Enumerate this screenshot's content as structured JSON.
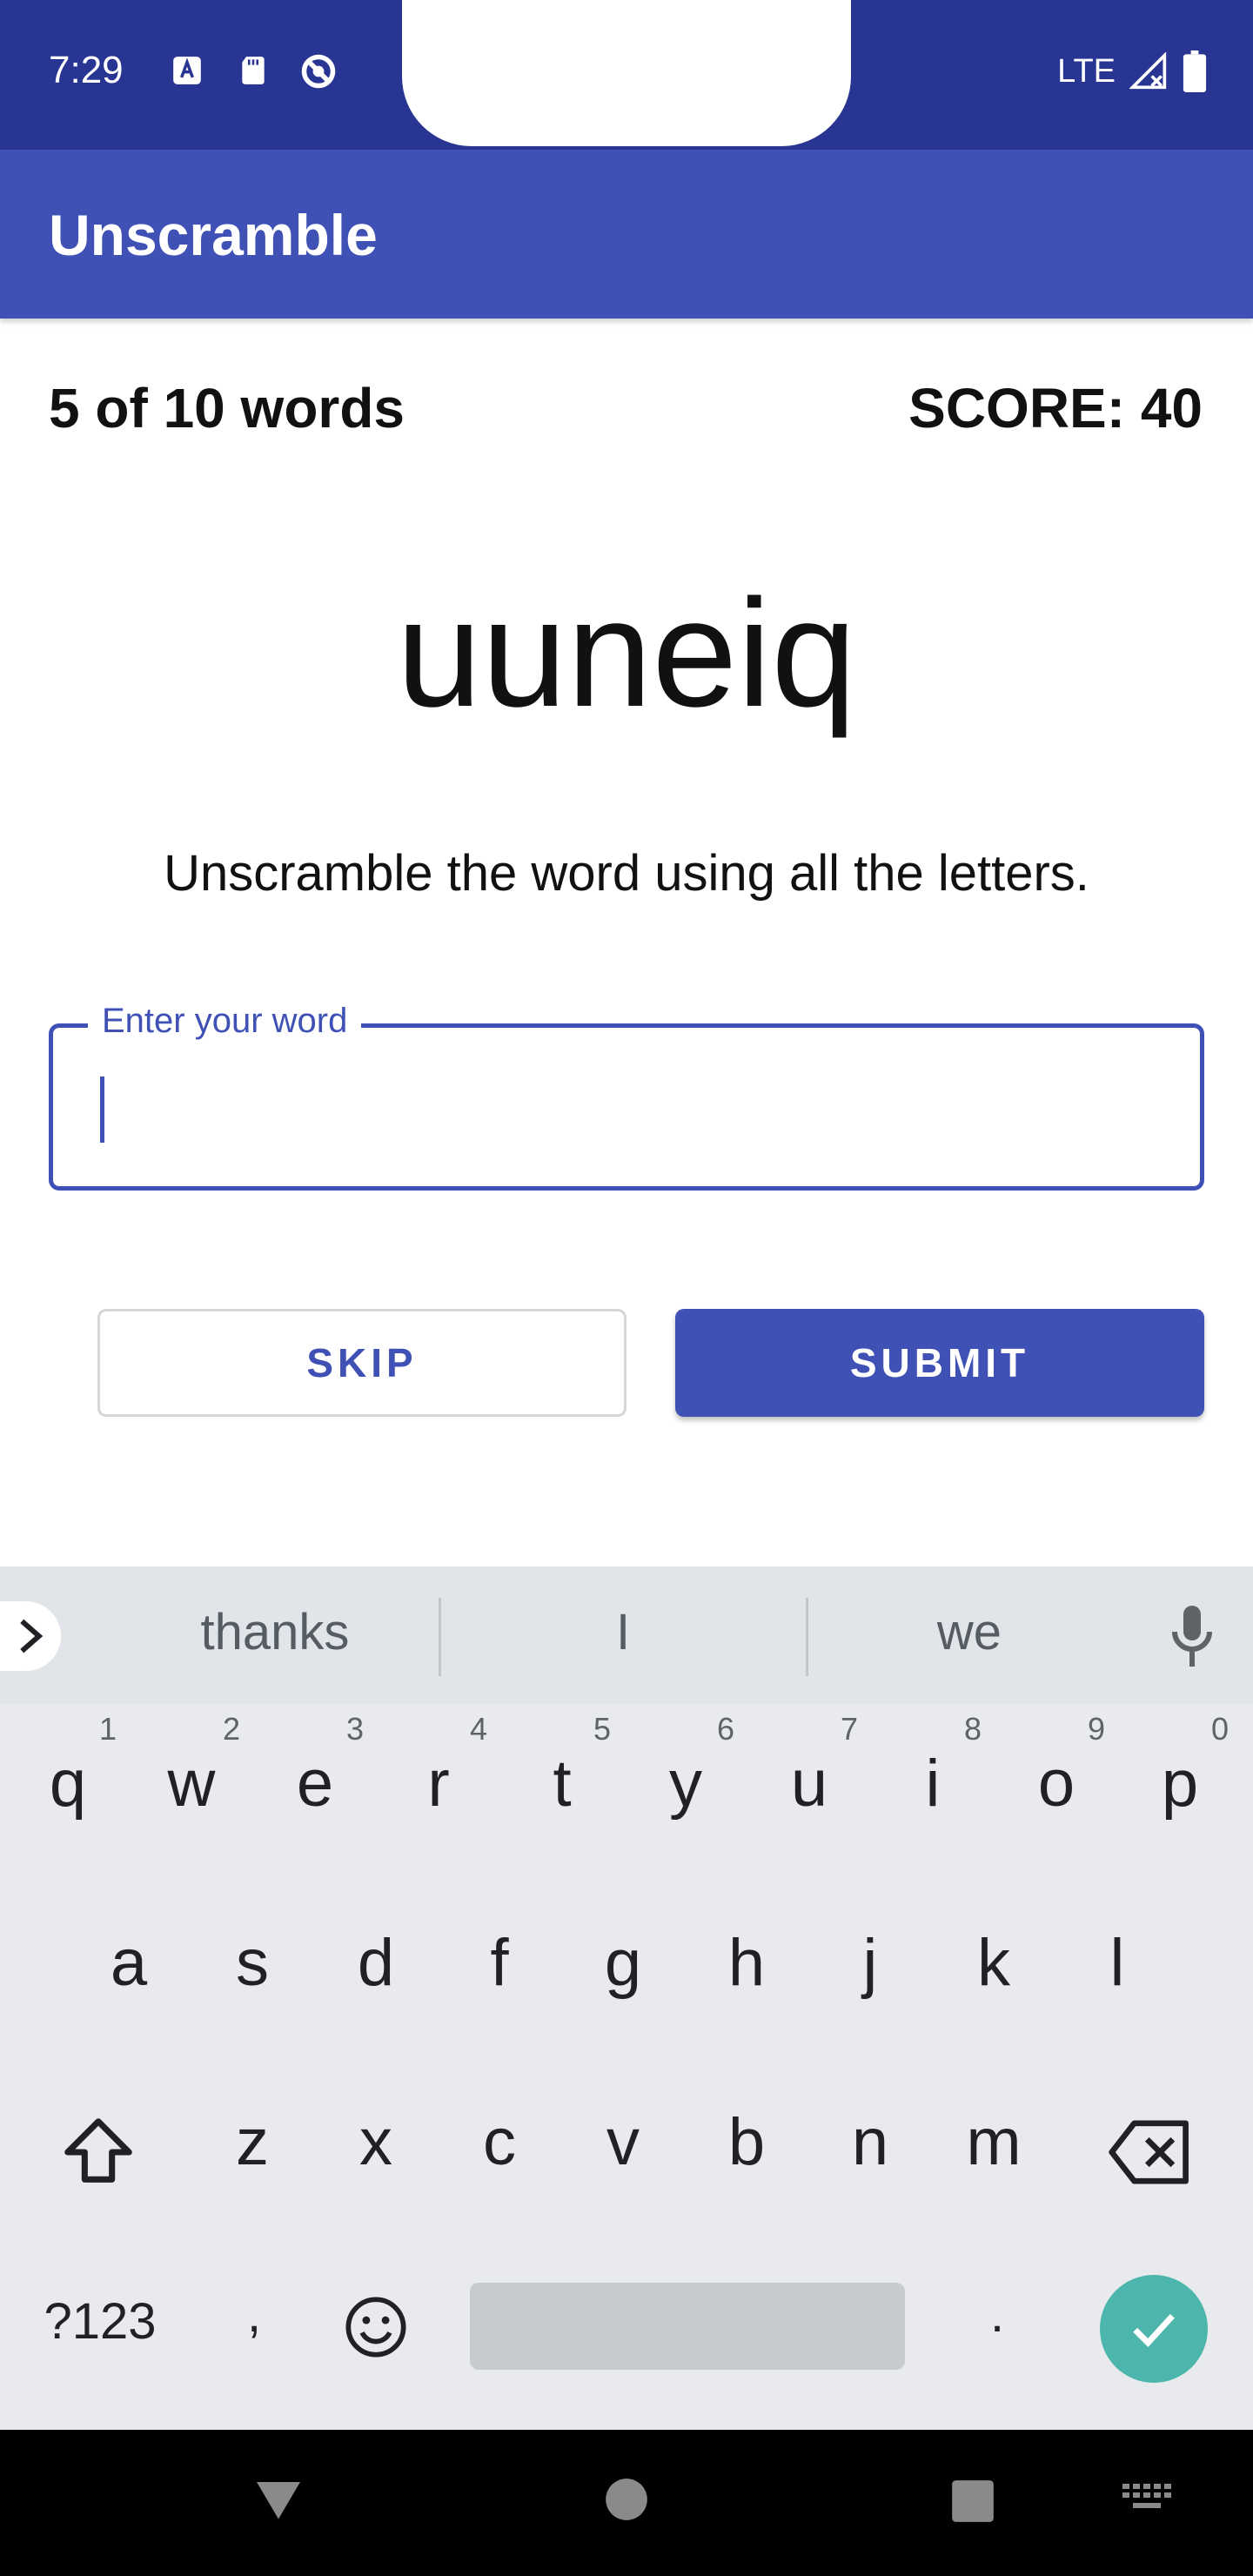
{
  "status_bar": {
    "time": "7:29",
    "network": "LTE",
    "icons": [
      "font-notification-icon",
      "sd-card-icon",
      "data-saver-icon",
      "signal-icon",
      "battery-icon"
    ]
  },
  "app_bar": {
    "title": "Unscramble"
  },
  "game": {
    "progress": "5 of 10 words",
    "score": "SCORE: 40",
    "scrambled_word": "uuneiq",
    "instructions": "Unscramble the word using all the letters."
  },
  "input": {
    "label": "Enter your word",
    "value": ""
  },
  "buttons": {
    "skip": "SKIP",
    "submit": "SUBMIT"
  },
  "keyboard": {
    "suggestions": [
      "thanks",
      "I",
      "we"
    ],
    "row1": [
      "q",
      "w",
      "e",
      "r",
      "t",
      "y",
      "u",
      "i",
      "o",
      "p"
    ],
    "row1_hints": [
      "1",
      "2",
      "3",
      "4",
      "5",
      "6",
      "7",
      "8",
      "9",
      "0"
    ],
    "row2": [
      "a",
      "s",
      "d",
      "f",
      "g",
      "h",
      "j",
      "k",
      "l"
    ],
    "row3": [
      "z",
      "x",
      "c",
      "v",
      "b",
      "n",
      "m"
    ],
    "symbols_label": "?123",
    "comma": ",",
    "period": "."
  },
  "colors": {
    "primary": "#3f51b5",
    "primary_dark": "#283593",
    "keyboard_bg": "#e8eaed",
    "enter_key": "#4db6ac"
  }
}
